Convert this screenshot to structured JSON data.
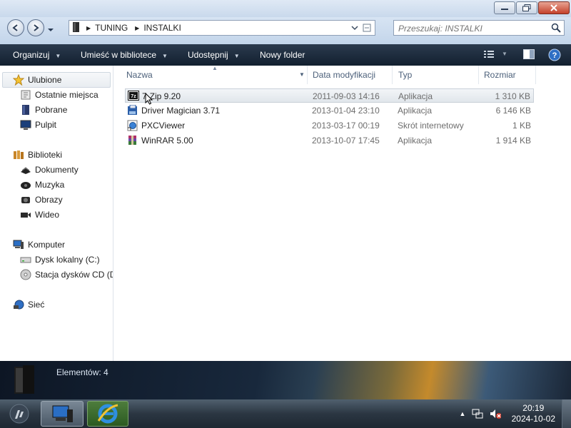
{
  "window": {
    "address": {
      "segments": [
        "TUNING",
        "INSTALKI"
      ]
    },
    "search": {
      "placeholder": "Przeszukaj: INSTALKI"
    }
  },
  "toolbar": {
    "organize": "Organizuj",
    "include_library": "Umieść w bibliotece",
    "share": "Udostępnij",
    "new_folder": "Nowy folder"
  },
  "nav": {
    "favorites": {
      "label": "Ulubione",
      "items": [
        {
          "label": "Ostatnie miejsca"
        },
        {
          "label": "Pobrane"
        },
        {
          "label": "Pulpit"
        }
      ]
    },
    "libraries": {
      "label": "Biblioteki",
      "items": [
        {
          "label": "Dokumenty"
        },
        {
          "label": "Muzyka"
        },
        {
          "label": "Obrazy"
        },
        {
          "label": "Wideo"
        }
      ]
    },
    "computer": {
      "label": "Komputer",
      "items": [
        {
          "label": "Dysk lokalny (C:)"
        },
        {
          "label": "Stacja dysków CD (D"
        }
      ]
    },
    "network": {
      "label": "Sieć"
    }
  },
  "files": {
    "columns": [
      "Nazwa",
      "Data modyfikacji",
      "Typ",
      "Rozmiar"
    ],
    "rows": [
      {
        "name": "7-Zip 9.20",
        "date": "2011-09-03 14:16",
        "type": "Aplikacja",
        "size": "1 310 KB",
        "icon": "7zip-icon"
      },
      {
        "name": "Driver Magician 3.71",
        "date": "2013-01-04 23:10",
        "type": "Aplikacja",
        "size": "6 146 KB",
        "icon": "driver-magician-icon"
      },
      {
        "name": "PXCViewer",
        "date": "2013-03-17 00:19",
        "type": "Skrót internetowy",
        "size": "1 KB",
        "icon": "internet-shortcut-icon"
      },
      {
        "name": "WinRAR 5.00",
        "date": "2013-10-07 17:45",
        "type": "Aplikacja",
        "size": "1 914 KB",
        "icon": "winrar-icon"
      }
    ]
  },
  "status": {
    "items_count": "Elementów: 4"
  },
  "taskbar": {
    "time": "20:19",
    "date": "2024-10-02"
  },
  "colors": {
    "accent": "#1e3a5c",
    "selection": "#e6eaee",
    "toolbar": "#1b2b3d"
  }
}
